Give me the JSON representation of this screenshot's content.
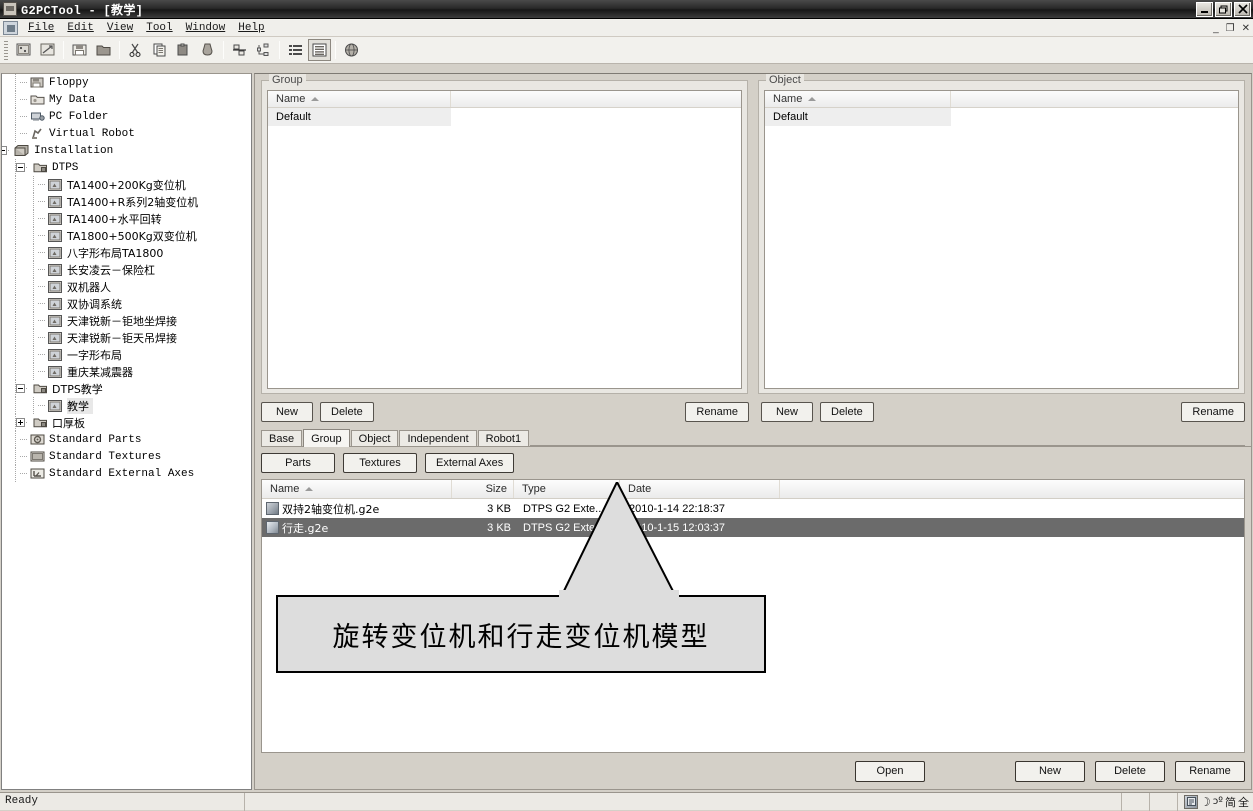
{
  "window": {
    "title": "G2PCTool - [教学]",
    "app_icon": "app-icon",
    "minimize": "–",
    "maximize": "❐",
    "close": "✕",
    "inner_minimize": "_",
    "inner_restore": "❐",
    "inner_close": "✕"
  },
  "menubar": {
    "items": [
      "File",
      "Edit",
      "View",
      "Tool",
      "Window",
      "Help"
    ]
  },
  "toolbar": {
    "icons": [
      "new-project-icon",
      "open-project-icon",
      "save-icon",
      "folder-icon",
      "cut-icon",
      "copy-icon",
      "paste-icon",
      "delete-icon",
      "align-icon",
      "tree-icon",
      "list-view-icon",
      "details-view-icon",
      "globe-icon"
    ]
  },
  "tree": {
    "items": [
      {
        "label": "Floppy",
        "indent": 1,
        "icon": "floppy-icon",
        "expander": "none"
      },
      {
        "label": "My Data",
        "indent": 1,
        "icon": "mydata-icon",
        "expander": "none"
      },
      {
        "label": "PC Folder",
        "indent": 1,
        "icon": "pc-folder-icon",
        "expander": "none"
      },
      {
        "label": "Virtual Robot",
        "indent": 1,
        "icon": "virtual-robot-icon",
        "expander": "none"
      },
      {
        "label": "Installation",
        "indent": 0,
        "icon": "installation-icon",
        "expander": "minus"
      },
      {
        "label": "DTPS",
        "indent": 1,
        "icon": "folder-icon",
        "expander": "minus"
      },
      {
        "label": "TA1400+200Kg变位机",
        "indent": 2,
        "icon": "model-icon",
        "expander": "none",
        "cjk": true
      },
      {
        "label": "TA1400+R系列2轴变位机",
        "indent": 2,
        "icon": "model-icon",
        "expander": "none",
        "cjk": true
      },
      {
        "label": "TA1400+水平回转",
        "indent": 2,
        "icon": "model-icon",
        "expander": "none",
        "cjk": true
      },
      {
        "label": "TA1800+500Kg双变位机",
        "indent": 2,
        "icon": "model-icon",
        "expander": "none",
        "cjk": true
      },
      {
        "label": "八字形布局TA1800",
        "indent": 2,
        "icon": "model-icon",
        "expander": "none",
        "cjk": true
      },
      {
        "label": "长安凌云－保险杠",
        "indent": 2,
        "icon": "model-icon",
        "expander": "none",
        "cjk": true
      },
      {
        "label": "双机器人",
        "indent": 2,
        "icon": "model-icon",
        "expander": "none",
        "cjk": true
      },
      {
        "label": "双协调系统",
        "indent": 2,
        "icon": "model-icon",
        "expander": "none",
        "cjk": true
      },
      {
        "label": "天津锐新－钜地坐焊接",
        "indent": 2,
        "icon": "model-icon",
        "expander": "none",
        "cjk": true
      },
      {
        "label": "天津锐新－钜天吊焊接",
        "indent": 2,
        "icon": "model-icon",
        "expander": "none",
        "cjk": true
      },
      {
        "label": "一字形布局",
        "indent": 2,
        "icon": "model-icon",
        "expander": "none",
        "cjk": true
      },
      {
        "label": "重庆某减震器",
        "indent": 2,
        "icon": "model-icon",
        "expander": "none",
        "cjk": true
      },
      {
        "label": "DTPS教学",
        "indent": 1,
        "icon": "folder-icon",
        "expander": "minus",
        "cjk": true
      },
      {
        "label": "教学",
        "indent": 2,
        "icon": "model-icon",
        "expander": "none",
        "cjk": true,
        "selected": true
      },
      {
        "label": "口厚板",
        "indent": 1,
        "icon": "folder-icon",
        "expander": "plus",
        "cjk": true
      },
      {
        "label": "Standard Parts",
        "indent": 1,
        "icon": "standard-parts-icon",
        "expander": "none"
      },
      {
        "label": "Standard Textures",
        "indent": 1,
        "icon": "standard-textures-icon",
        "expander": "none"
      },
      {
        "label": "Standard External Axes",
        "indent": 1,
        "icon": "standard-axes-icon",
        "expander": "none"
      }
    ]
  },
  "group_panel": {
    "title": "Group",
    "column_header": "Name",
    "rows": [
      "Default"
    ],
    "buttons": {
      "new": "New",
      "delete": "Delete",
      "rename": "Rename"
    }
  },
  "object_panel": {
    "title": "Object",
    "column_header": "Name",
    "rows": [
      "Default"
    ],
    "buttons": {
      "new": "New",
      "delete": "Delete",
      "rename": "Rename"
    }
  },
  "tabs": {
    "items": [
      "Base",
      "Group",
      "Object",
      "Independent",
      "Robot1"
    ],
    "active": "Group"
  },
  "subbuttons": [
    "Parts",
    "Textures",
    "External Axes"
  ],
  "filelist": {
    "columns": [
      "Name",
      "Size",
      "Type",
      "Date"
    ],
    "rows": [
      {
        "name": "双持2轴变位机.g2e",
        "size": "3 KB",
        "type": "DTPS G2 Exte..",
        "date": "2010-1-14 22:18:37",
        "selected": false
      },
      {
        "name": "行走.g2e",
        "size": "3 KB",
        "type": "DTPS G2 Exte..",
        "date": "2010-1-15 12:03:37",
        "selected": true
      }
    ]
  },
  "callout": {
    "text": "旋转变位机和行走变位机模型"
  },
  "footer_buttons": {
    "open": "Open",
    "new": "New",
    "delete": "Delete",
    "rename": "Rename"
  },
  "statusbar": {
    "text": "Ready",
    "tray": [
      "ime-icon",
      "moon-icon",
      "pinyin-icon",
      "简",
      "全"
    ]
  },
  "colors": {
    "titlebar": "#2a2a2a",
    "selection": "#6b6b6b",
    "face": "#d4d0c8",
    "callout_fill": "#dddddd"
  }
}
